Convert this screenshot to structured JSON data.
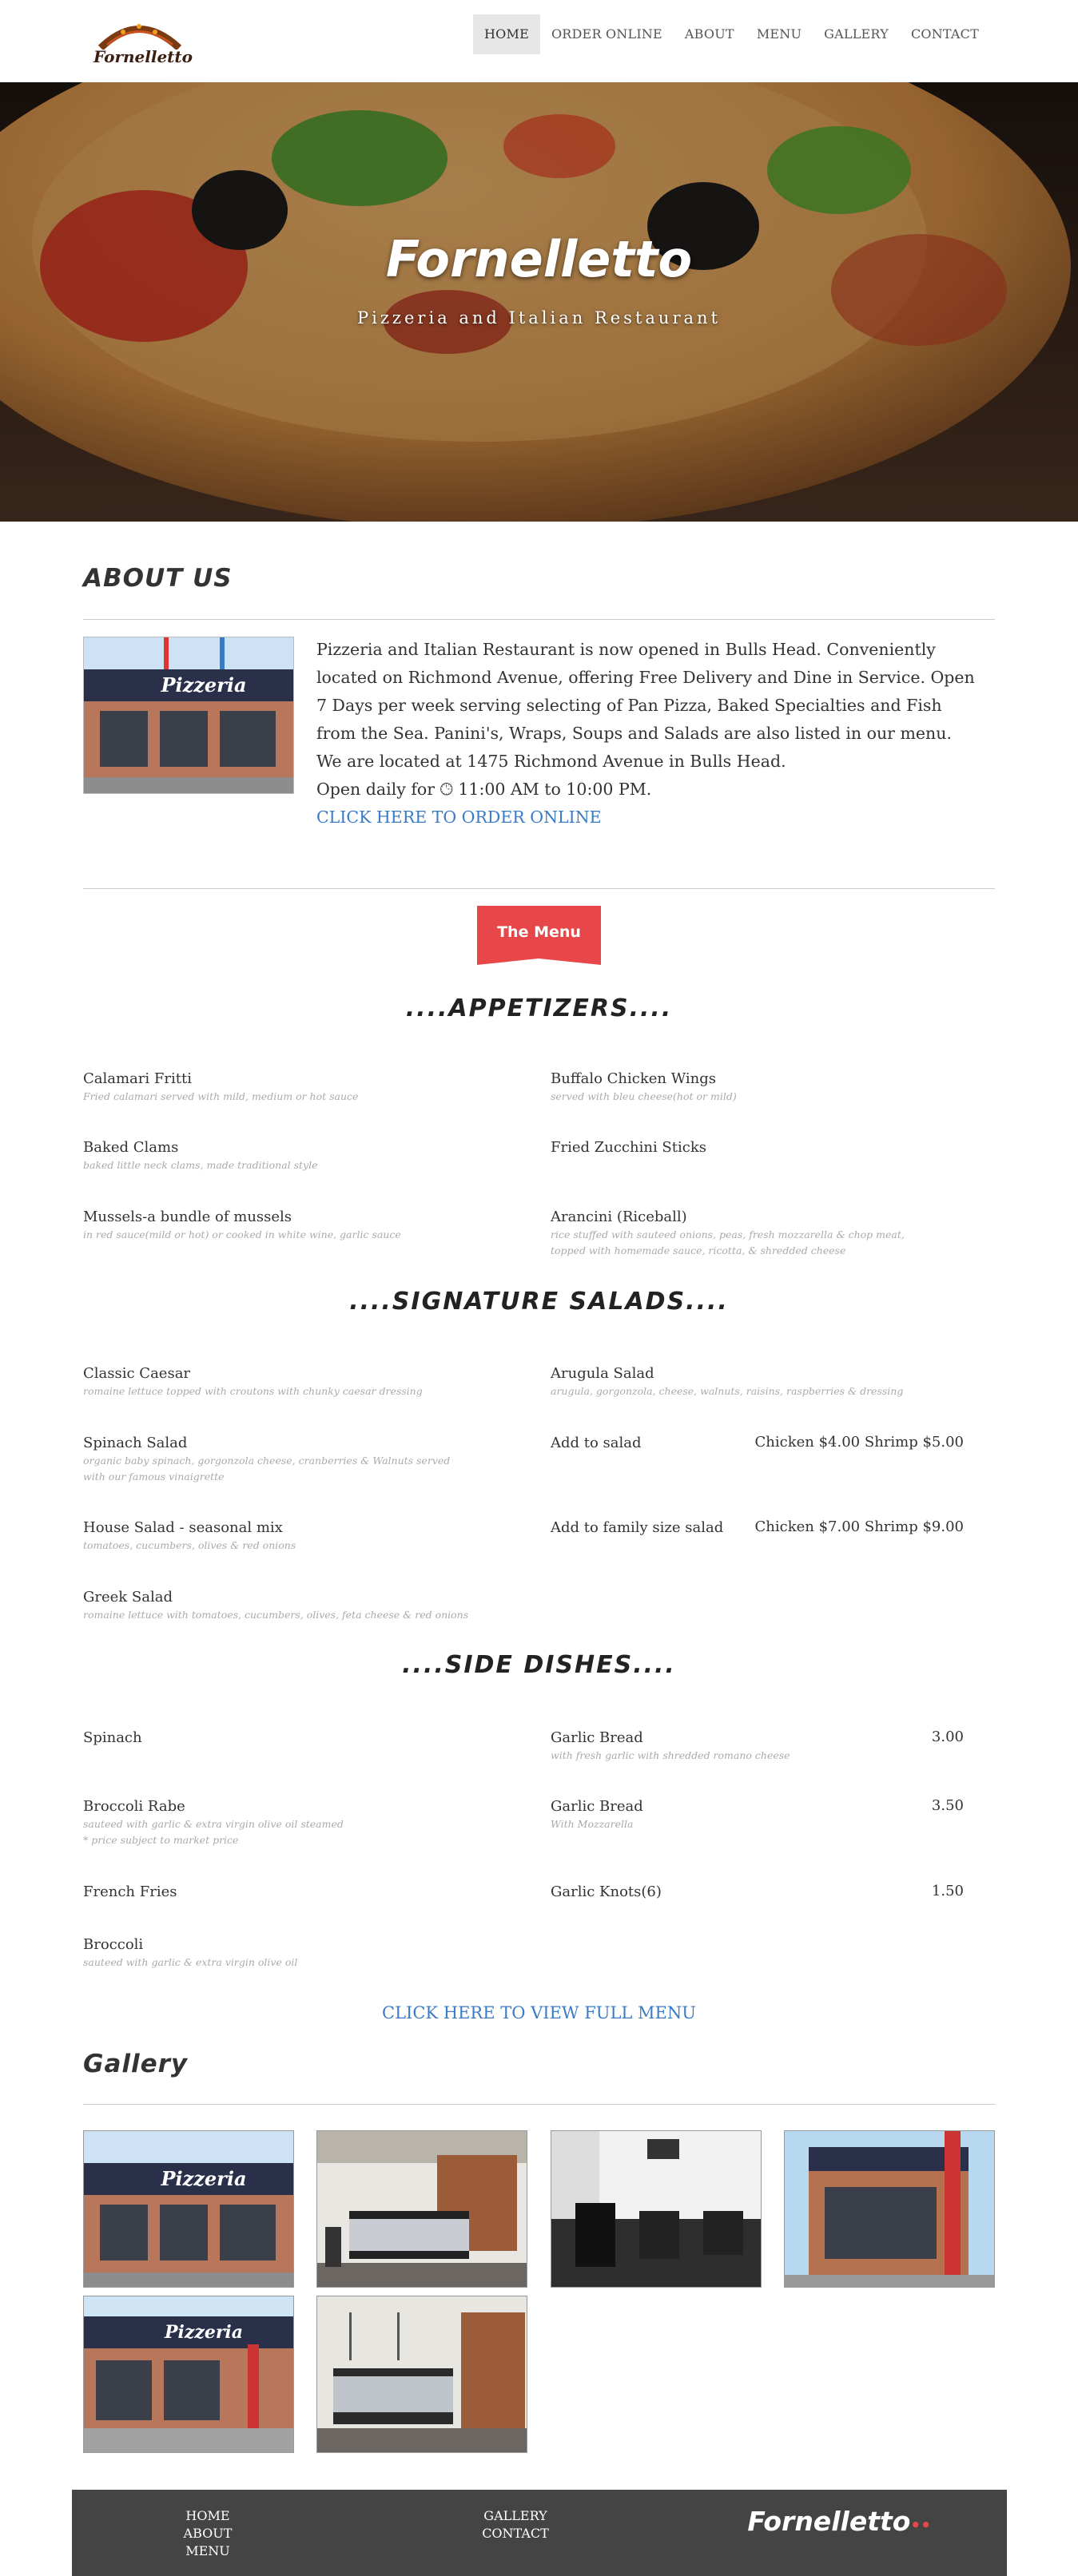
{
  "nav": {
    "logo_text": "Fornelletto",
    "items": [
      "HOME",
      "ORDER ONLINE",
      "ABOUT",
      "MENU",
      "GALLERY",
      "CONTACT"
    ]
  },
  "hero": {
    "title": "Fornelletto",
    "subtitle": "Pizzeria and Italian Restaurant"
  },
  "about": {
    "heading": "ABOUT US",
    "paragraph": "Pizzeria and Italian Restaurant is now opened in Bulls Head. Conveniently located on Richmond Avenue, offering Free Delivery and Dine in Service. Open 7 Days per week serving selecting of Pan Pizza, Baked Specialties and Fish from the Sea. Panini's, Wraps, Soups and Salads are also listed in our menu.",
    "location": "We are located at 1475 Richmond Avenue in Bulls Head.",
    "hours_prefix": "Open daily for",
    "hours": "11:00 AM to 10:00 PM.",
    "order_link": "CLICK HERE TO ORDER ONLINE",
    "image_sign": "Pizzeria"
  },
  "menu_badge": "The Menu",
  "appetizers": {
    "title": "....APPETIZERS....",
    "left": [
      {
        "name": "Calamari Fritti",
        "desc": "Fried calamari served with mild, medium or hot sauce"
      },
      {
        "name": "Baked Clams",
        "desc": "baked little neck clams, made traditional style"
      },
      {
        "name": "Mussels-a bundle of mussels",
        "desc": "in red sauce(mild or hot) or cooked in white wine, garlic sauce"
      }
    ],
    "right": [
      {
        "name": "Buffalo Chicken Wings",
        "desc": "served with bleu cheese(hot or mild)"
      },
      {
        "name": "Fried Zucchini Sticks",
        "desc": ""
      },
      {
        "name": "Arancini (Riceball)",
        "desc": "rice stuffed with sauteed onions, peas, fresh mozzarella & chop meat,",
        "desc2": "topped with homemade sauce, ricotta, & shredded cheese"
      }
    ]
  },
  "salads": {
    "title": "....SIGNATURE SALADS....",
    "left": [
      {
        "name": "Classic Caesar",
        "desc": "romaine lettuce topped with croutons with chunky caesar dressing"
      },
      {
        "name": "Spinach Salad",
        "desc": "organic baby spinach, gorgonzola cheese, cranberries & Walnuts served",
        "desc2": "with our famous vinaigrette"
      },
      {
        "name": "House Salad - seasonal mix",
        "desc": "tomatoes, cucumbers, olives & red onions"
      },
      {
        "name": "Greek Salad",
        "desc": "romaine lettuce with tomatoes, cucumbers, olives, feta cheese & red onions"
      }
    ],
    "right": [
      {
        "name": "Arugula Salad",
        "desc": "arugula, gorgonzola, cheese, walnuts, raisins, raspberries & dressing",
        "price": ""
      },
      {
        "name": "Add to salad",
        "desc": "",
        "price": "Chicken $4.00 Shrimp $5.00"
      },
      {
        "name": "Add to family size salad",
        "desc": "",
        "price": "Chicken $7.00 Shrimp $9.00"
      }
    ]
  },
  "sides": {
    "title": "....SIDE DISHES....",
    "left": [
      {
        "name": "Spinach",
        "desc": ""
      },
      {
        "name": "Broccoli Rabe",
        "desc": "sauteed with garlic & extra virgin olive oil steamed",
        "desc2": "* price subject to market price"
      },
      {
        "name": "French Fries",
        "desc": ""
      },
      {
        "name": "Broccoli",
        "desc": "sauteed with garlic & extra virgin olive oil"
      }
    ],
    "right": [
      {
        "name": "Garlic Bread",
        "desc": "with fresh garlic with shredded romano cheese",
        "price": "3.00"
      },
      {
        "name": "Garlic Bread",
        "desc": "With Mozzarella",
        "price": "3.50"
      },
      {
        "name": "Garlic Knots(6)",
        "desc": "",
        "price": "1.50"
      }
    ]
  },
  "full_menu_link": "CLICK HERE TO VIEW FULL MENU",
  "gallery": {
    "heading": "Gallery",
    "sign": "Pizzeria"
  },
  "footer": {
    "col1": [
      "HOME",
      "ABOUT",
      "MENU"
    ],
    "col2": [
      "GALLERY",
      "CONTACT"
    ],
    "logo": "Fornelletto"
  },
  "colors": {
    "accent": "#e8474a",
    "link": "#3a7bc8",
    "footer_bg": "#444444"
  }
}
